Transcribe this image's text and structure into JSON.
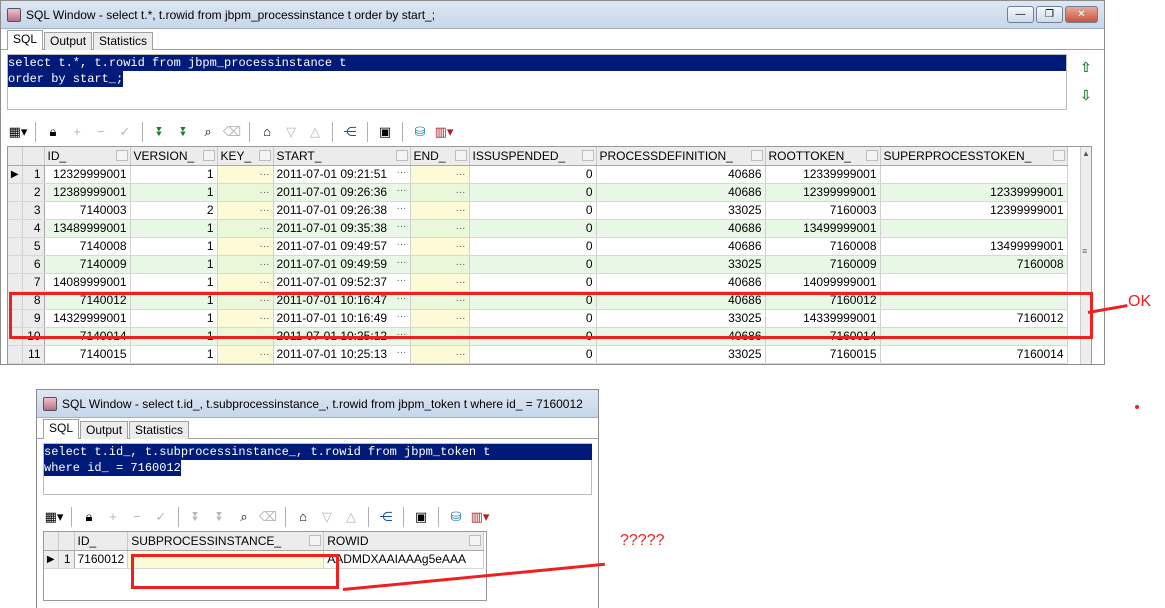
{
  "window1": {
    "title": "SQL Window - select t.*, t.rowid from jbpm_processinstance t order by start_;",
    "tabs": [
      "SQL",
      "Output",
      "Statistics"
    ],
    "sql_lines": [
      "select t.*, t.rowid from jbpm_processinstance t",
      "order by start_;"
    ],
    "columns": [
      "ID_",
      "VERSION_",
      "KEY_",
      "START_",
      "END_",
      "ISSUSPENDED_",
      "PROCESSDEFINITION_",
      "ROOTTOKEN_",
      "SUPERPROCESSTOKEN_"
    ],
    "rows": [
      {
        "n": "1",
        "id": "12329999001",
        "version": "1",
        "start": "2011-07-01 09:21:51",
        "suspended": "0",
        "procdef": "40686",
        "roottoken": "12339999001",
        "super": ""
      },
      {
        "n": "2",
        "id": "12389999001",
        "version": "1",
        "start": "2011-07-01 09:26:36",
        "suspended": "0",
        "procdef": "40686",
        "roottoken": "12399999001",
        "super": "12339999001"
      },
      {
        "n": "3",
        "id": "7140003",
        "version": "2",
        "start": "2011-07-01 09:26:38",
        "suspended": "0",
        "procdef": "33025",
        "roottoken": "7160003",
        "super": "12399999001"
      },
      {
        "n": "4",
        "id": "13489999001",
        "version": "1",
        "start": "2011-07-01 09:35:38",
        "suspended": "0",
        "procdef": "40686",
        "roottoken": "13499999001",
        "super": ""
      },
      {
        "n": "5",
        "id": "7140008",
        "version": "1",
        "start": "2011-07-01 09:49:57",
        "suspended": "0",
        "procdef": "40686",
        "roottoken": "7160008",
        "super": "13499999001"
      },
      {
        "n": "6",
        "id": "7140009",
        "version": "1",
        "start": "2011-07-01 09:49:59",
        "suspended": "0",
        "procdef": "33025",
        "roottoken": "7160009",
        "super": "7160008"
      },
      {
        "n": "7",
        "id": "14089999001",
        "version": "1",
        "start": "2011-07-01 09:52:37",
        "suspended": "0",
        "procdef": "40686",
        "roottoken": "14099999001",
        "super": ""
      },
      {
        "n": "8",
        "id": "7140012",
        "version": "1",
        "start": "2011-07-01 10:16:47",
        "suspended": "0",
        "procdef": "40686",
        "roottoken": "7160012",
        "super": ""
      },
      {
        "n": "9",
        "id": "14329999001",
        "version": "1",
        "start": "2011-07-01 10:16:49",
        "suspended": "0",
        "procdef": "33025",
        "roottoken": "14339999001",
        "super": "7160012"
      },
      {
        "n": "10",
        "id": "7140014",
        "version": "1",
        "start": "2011-07-01 10:25:12",
        "suspended": "0",
        "procdef": "40686",
        "roottoken": "7160014",
        "super": ""
      },
      {
        "n": "11",
        "id": "7140015",
        "version": "1",
        "start": "2011-07-01 10:25:13",
        "suspended": "0",
        "procdef": "33025",
        "roottoken": "7160015",
        "super": "7160014"
      }
    ]
  },
  "window2": {
    "title": "SQL Window - select t.id_, t.subprocessinstance_, t.rowid from jbpm_token t where id_ = 7160012",
    "tabs": [
      "SQL",
      "Output",
      "Statistics"
    ],
    "sql_lines": [
      "select t.id_, t.subprocessinstance_, t.rowid from jbpm_token t",
      "where id_ = 7160012"
    ],
    "columns": [
      "ID_",
      "SUBPROCESSINSTANCE_",
      "ROWID"
    ],
    "rows": [
      {
        "n": "1",
        "id": "7160012",
        "subprocess": "",
        "rowid": "AADMDXAAIAAAg5eAAA"
      }
    ]
  },
  "annotations": {
    "ok_text": "OK",
    "question_text": "?????",
    "color": "#ee2020"
  },
  "icons": {
    "window_buttons": [
      "minimize-icon",
      "restore-icon",
      "close-icon"
    ],
    "toolbar": [
      "grid-view-icon",
      "lock-icon",
      "add-record-icon",
      "delete-record-icon",
      "post-icon",
      "fetch-next-icon",
      "fetch-last-icon",
      "find-icon",
      "clear-icon",
      "query-by-example-icon",
      "filter-down-icon",
      "filter-up-icon",
      "explain-icon",
      "save-icon",
      "export-icon",
      "chart-icon"
    ]
  }
}
